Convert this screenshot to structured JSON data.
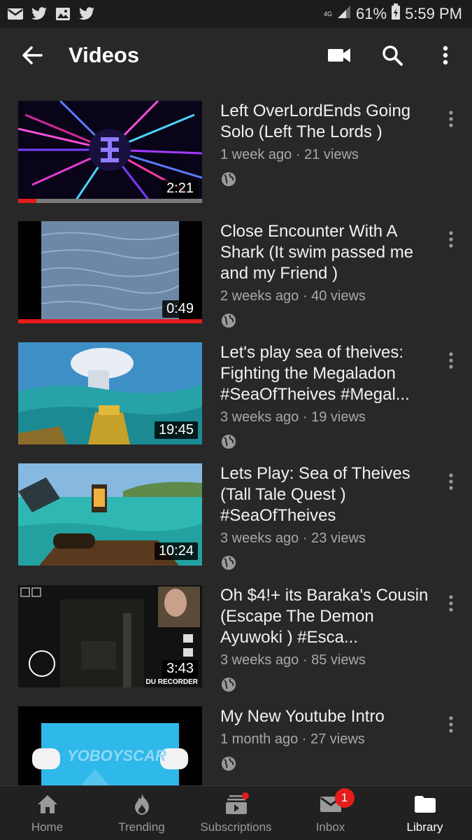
{
  "status_bar": {
    "network": "4G",
    "battery": "61%",
    "time": "5:59 PM"
  },
  "app_bar": {
    "title": "Videos"
  },
  "videos": [
    {
      "title": "Left OverLordEnds Going Solo (Left The Lords )",
      "age": "1 week ago",
      "views": "21 views",
      "duration": "2:21",
      "watched": 0.1
    },
    {
      "title": "Close Encounter With A Shark (It swim passed me and my Friend )",
      "age": "2 weeks ago",
      "views": "40 views",
      "duration": "0:49",
      "watched": 1.0
    },
    {
      "title": "Let's play sea of theives: Fighting the Megaladon #SeaOfTheives #Megal...",
      "age": "3 weeks ago",
      "views": "19 views",
      "duration": "19:45"
    },
    {
      "title": "Lets Play: Sea of Theives (Tall Tale Quest ) #SeaOfTheives",
      "age": "3 weeks ago",
      "views": "23 views",
      "duration": "10:24"
    },
    {
      "title": "Oh $4!+ its Baraka's Cousin (Escape The Demon Ayuwoki ) #Esca...",
      "age": "3 weeks ago",
      "views": "85 views",
      "duration": "3:43"
    },
    {
      "title": "My New Youtube Intro",
      "age": "1 month ago",
      "views": "27 views",
      "duration": ""
    }
  ],
  "thumb_text": {
    "recorder": "DU RECORDER",
    "intro": "YOBOYSCAR"
  },
  "bottom_nav": [
    {
      "label": "Home",
      "icon": "home-icon"
    },
    {
      "label": "Trending",
      "icon": "flame-icon"
    },
    {
      "label": "Subscriptions",
      "icon": "subscriptions-icon"
    },
    {
      "label": "Inbox",
      "icon": "inbox-icon",
      "badge": "1"
    },
    {
      "label": "Library",
      "icon": "library-icon",
      "active": true
    }
  ],
  "colors": {
    "background": "#282828",
    "accent": "#e51c1c",
    "secondary_text": "#a8a8a8"
  }
}
